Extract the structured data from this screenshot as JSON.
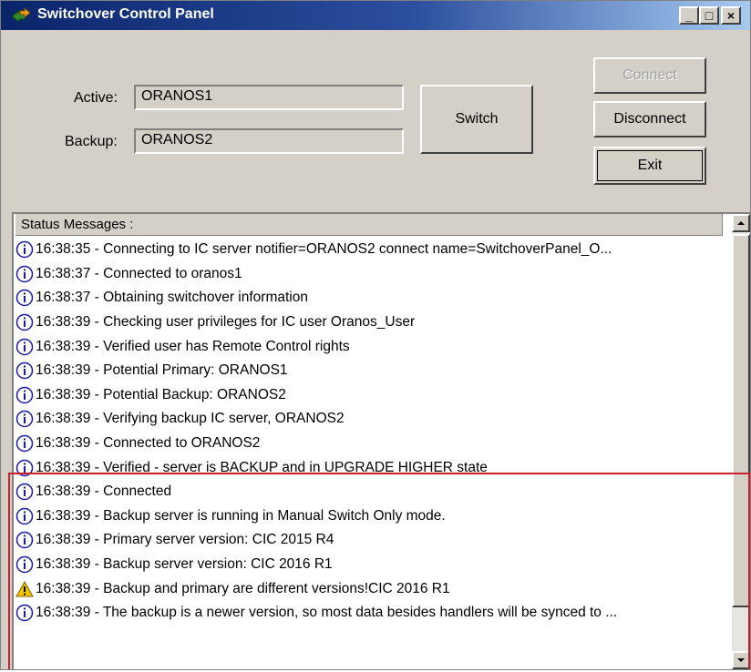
{
  "window": {
    "title": "Switchover Control Panel"
  },
  "titlebar_buttons": {
    "minimize": "_",
    "maximize": "□",
    "close": "×"
  },
  "servers": {
    "active_label": "Active:",
    "active_value": "ORANOS1",
    "backup_label": "Backup:",
    "backup_value": "ORANOS2"
  },
  "buttons": {
    "switch": "Switch",
    "connect": "Connect",
    "disconnect": "Disconnect",
    "exit": "Exit"
  },
  "status": {
    "header": "Status Messages :",
    "messages": [
      {
        "icon": "info-icon",
        "text": "16:38:35 - Connecting to IC server notifier=ORANOS2 connect name=SwitchoverPanel_O..."
      },
      {
        "icon": "info-icon",
        "text": "16:38:37 - Connected to oranos1"
      },
      {
        "icon": "info-icon",
        "text": "16:38:37 - Obtaining switchover information"
      },
      {
        "icon": "info-icon",
        "text": "16:38:39 - Checking user privileges for IC user Oranos_User"
      },
      {
        "icon": "info-icon",
        "text": "16:38:39 - Verified user has Remote Control rights"
      },
      {
        "icon": "info-icon",
        "text": "16:38:39 - Potential Primary:  ORANOS1"
      },
      {
        "icon": "info-icon",
        "text": "16:38:39 - Potential Backup:  ORANOS2"
      },
      {
        "icon": "info-icon",
        "text": "16:38:39 - Verifying backup IC server, ORANOS2"
      },
      {
        "icon": "info-icon",
        "text": "16:38:39 - Connected to ORANOS2"
      },
      {
        "icon": "info-icon",
        "text": "16:38:39 - Verified - server is BACKUP and in UPGRADE HIGHER state"
      },
      {
        "icon": "info-icon",
        "text": "16:38:39 - Connected"
      },
      {
        "icon": "info-icon",
        "text": "16:38:39 - Backup server is running in Manual Switch Only mode."
      },
      {
        "icon": "info-icon",
        "text": "16:38:39 - Primary server version: CIC 2015 R4"
      },
      {
        "icon": "info-icon",
        "text": "16:38:39 - Backup server version: CIC 2016 R1"
      },
      {
        "icon": "warning-icon",
        "text": "16:38:39 - Backup and primary are different versions!CIC 2016 R1"
      },
      {
        "icon": "info-icon",
        "text": "16:38:39 - The backup is a newer version, so most data besides handlers will be synced to ..."
      }
    ]
  },
  "colors": {
    "titlebar_start": "#0a246a",
    "titlebar_end": "#a6caf0",
    "highlight_border": "#c8202a",
    "info_icon": "#1a1aa8",
    "warning_icon": "#f2c500"
  }
}
